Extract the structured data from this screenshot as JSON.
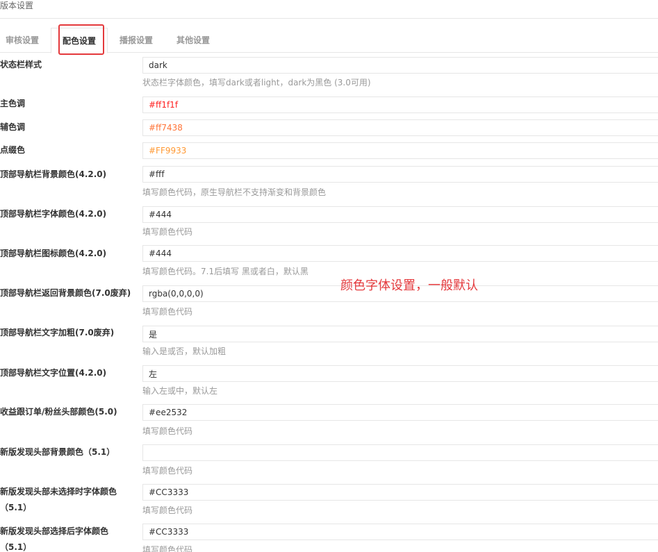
{
  "page_title": "版本设置",
  "tabs": [
    {
      "label": "审核设置",
      "active": false
    },
    {
      "label": "配色设置",
      "active": true
    },
    {
      "label": "播报设置",
      "active": false
    },
    {
      "label": "其他设置",
      "active": false
    }
  ],
  "fields": [
    {
      "label": "状态栏样式",
      "value": "dark",
      "color": "#333333",
      "help": "状态栏字体颜色，填写dark或者light，dark为黑色 (3.0可用)"
    },
    {
      "label": "主色调",
      "value": "#ff1f1f",
      "color": "#ff1f1f",
      "help": ""
    },
    {
      "label": "辅色调",
      "value": "#ff7438",
      "color": "#ff7438",
      "help": ""
    },
    {
      "label": "点缀色",
      "value": "#FF9933",
      "color": "#FF9933",
      "help": ""
    },
    {
      "label": "顶部导航栏背景颜色(4.2.0)",
      "value": "#fff",
      "color": "#333333",
      "help": "填写颜色代码，原生导航栏不支持渐变和背景颜色"
    },
    {
      "label": "顶部导航栏字体颜色(4.2.0)",
      "value": "#444",
      "color": "#333333",
      "help": "填写颜色代码"
    },
    {
      "label": "顶部导航栏图标颜色(4.2.0)",
      "value": "#444",
      "color": "#333333",
      "help": "填写颜色代码。7.1后填写 黑或者白，默认黑"
    },
    {
      "label": "顶部导航栏返回背景颜色(7.0废弃)",
      "value": "rgba(0,0,0,0)",
      "color": "#333333",
      "help": "填写颜色代码"
    },
    {
      "label": "顶部导航栏文字加粗(7.0废弃)",
      "value": "是",
      "color": "#333333",
      "help": "输入是或否，默认加粗"
    },
    {
      "label": "顶部导航栏文字位置(4.2.0)",
      "value": "左",
      "color": "#333333",
      "help": "输入左或中，默认左"
    },
    {
      "label": "收益跟订单/粉丝头部颜色(5.0)",
      "value": "#ee2532",
      "color": "#333333",
      "help": "填写颜色代码"
    },
    {
      "label": "新版发现头部背景颜色（5.1）",
      "value": "",
      "color": "#333333",
      "help": "填写颜色代码"
    },
    {
      "label": "新版发现头部未选择时字体颜色（5.1）",
      "value": "#CC3333",
      "color": "#333333",
      "help": "填写颜色代码"
    },
    {
      "label": "新版发现头部选择后字体颜色（5.1）",
      "value": "#CC3333",
      "color": "#333333",
      "help": "填写颜色代码"
    }
  ],
  "annotation": "颜色字体设置，一般默认",
  "colors": {
    "accent": "#e4393c",
    "border": "#e6e6e6",
    "help_text": "#999999"
  }
}
